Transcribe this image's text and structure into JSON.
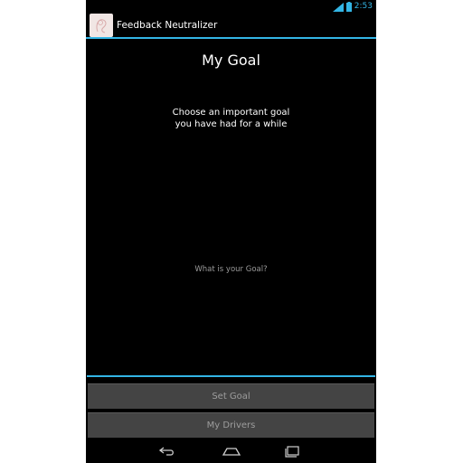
{
  "status_bar": {
    "time": "2:53",
    "icons": [
      "signal-icon",
      "battery-icon"
    ]
  },
  "action_bar": {
    "app_title": "Feedback Neutralizer",
    "app_icon": "app-logo-icon"
  },
  "main": {
    "title": "My Goal",
    "instruction_line1": "Choose an important goal",
    "instruction_line2": "you have had for a while",
    "goal_input": {
      "value": "",
      "placeholder": "What is your Goal?"
    }
  },
  "buttons": {
    "set_goal": "Set Goal",
    "my_drivers": "My Drivers"
  },
  "nav_bar": {
    "icons": [
      "back-icon",
      "home-icon",
      "recent-apps-icon"
    ]
  },
  "colors": {
    "accent": "#33b5e5",
    "background": "#000000",
    "button_bg": "#444444",
    "button_text": "#9d9d9d"
  }
}
